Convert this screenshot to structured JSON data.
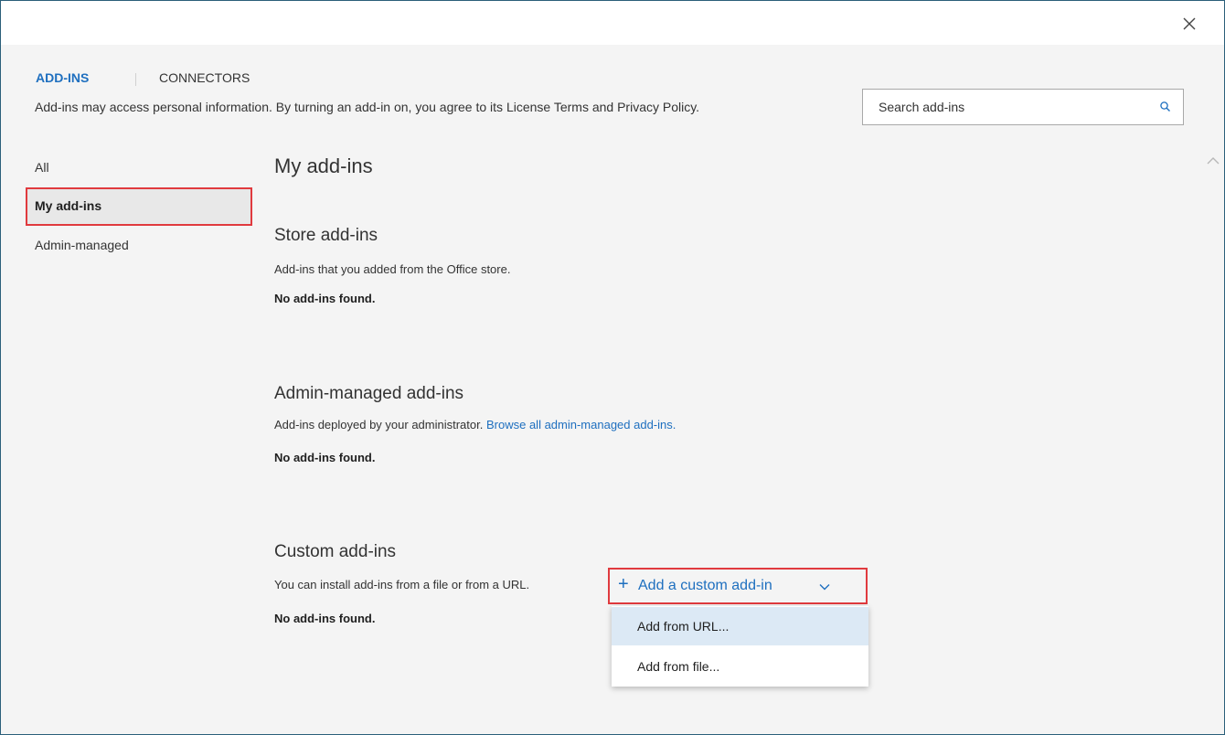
{
  "window": {
    "close_icon": "close-icon"
  },
  "tabs": [
    {
      "label": "ADD-INS",
      "active": true
    },
    {
      "label": "CONNECTORS",
      "active": false
    }
  ],
  "disclaimer": "Add-ins may access personal information. By turning an add-in on, you agree to its License Terms and Privacy Policy.",
  "search": {
    "placeholder": "Search add-ins",
    "icon": "search-icon"
  },
  "sidebar": {
    "items": [
      {
        "label": "All",
        "selected": false
      },
      {
        "label": "My add-ins",
        "selected": true
      },
      {
        "label": "Admin-managed",
        "selected": false
      }
    ]
  },
  "main": {
    "title": "My add-ins",
    "sections": [
      {
        "title": "Store add-ins",
        "description": "Add-ins that you added from the Office store.",
        "empty": "No add-ins found."
      },
      {
        "title": "Admin-managed add-ins",
        "description": "Add-ins deployed by your administrator.",
        "link": "Browse all admin-managed add-ins.",
        "empty": "No add-ins found."
      },
      {
        "title": "Custom add-ins",
        "description": "You can install add-ins from a file or from a URL.",
        "empty": "No add-ins found."
      }
    ]
  },
  "add_custom": {
    "plus": "+",
    "label": "Add a custom add-in",
    "menu": [
      {
        "label": "Add from URL..."
      },
      {
        "label": "Add from file..."
      }
    ]
  },
  "colors": {
    "accent": "#1e6fbf",
    "highlight_border": "#e03a3e",
    "menu_hover": "#dce9f5"
  }
}
